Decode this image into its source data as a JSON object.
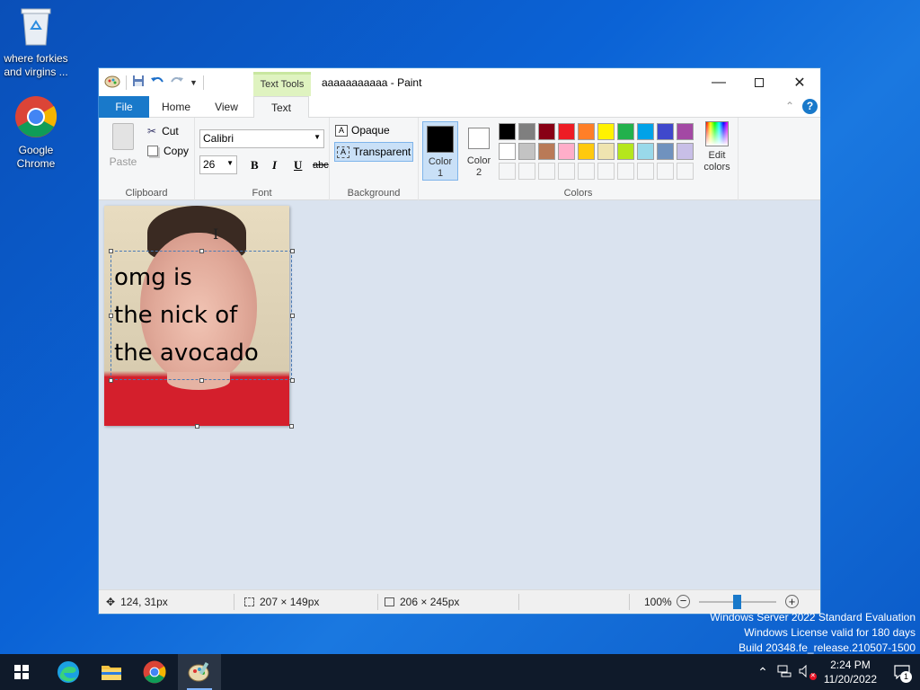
{
  "desktop": {
    "icons": [
      {
        "label": "where forkies and virgins ..."
      },
      {
        "label": "Google Chrome"
      }
    ],
    "watermark": {
      "line1": "Windows Server 2022 Standard Evaluation",
      "line2": "Windows License valid for 180 days",
      "line3": "Build 20348.fe_release.210507-1500"
    }
  },
  "window": {
    "title": "aaaaaaaaaaa - Paint",
    "context_tab": "Text Tools",
    "tabs": {
      "file": "File",
      "home": "Home",
      "view": "View",
      "text": "Text"
    }
  },
  "ribbon": {
    "clipboard": {
      "paste": "Paste",
      "cut": "Cut",
      "copy": "Copy",
      "label": "Clipboard"
    },
    "font": {
      "family": "Calibri",
      "size": "26",
      "label": "Font"
    },
    "background": {
      "opaque": "Opaque",
      "transparent": "Transparent",
      "label": "Background"
    },
    "colors": {
      "color1": "Color 1",
      "color2": "Color 2",
      "edit": "Edit colors",
      "label": "Colors",
      "row1": [
        "#000000",
        "#7f7f7f",
        "#880015",
        "#ed1c24",
        "#ff7f27",
        "#fff200",
        "#22b14c",
        "#00a2e8",
        "#3f48cc",
        "#a349a4"
      ],
      "row2": [
        "#ffffff",
        "#c3c3c3",
        "#b97a57",
        "#ffaec9",
        "#ffc90e",
        "#efe4b0",
        "#b5e61d",
        "#99d9ea",
        "#7092be",
        "#c8bfe7"
      ]
    }
  },
  "canvas": {
    "text_lines": [
      "omg is",
      "the nick of",
      "the avocado"
    ]
  },
  "status": {
    "cursor": "124, 31px",
    "selection": "207 × 149px",
    "image_size": "206 × 245px",
    "zoom": "100%"
  },
  "taskbar": {
    "time": "2:24 PM",
    "date": "11/20/2022",
    "notif_count": "1"
  }
}
